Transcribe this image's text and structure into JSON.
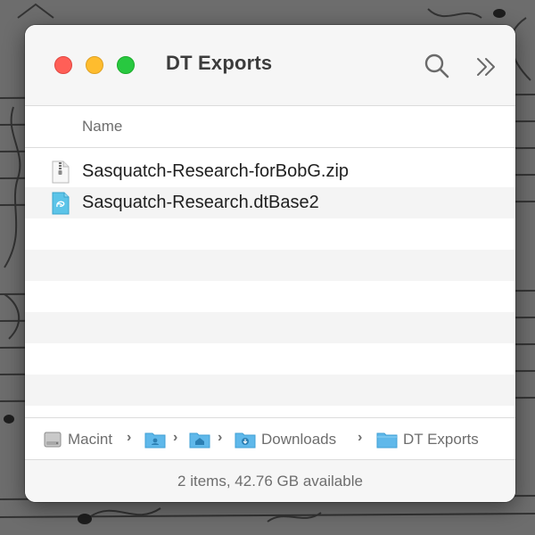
{
  "window": {
    "title": "DT Exports"
  },
  "toolbar": {
    "buttons": [
      {
        "icon": "close-button"
      },
      {
        "icon": "minimize-button"
      },
      {
        "icon": "zoom-button"
      },
      {
        "icon": "search-icon"
      },
      {
        "icon": "chevron-double-right-icon"
      }
    ]
  },
  "columns": {
    "name": "Name"
  },
  "files": [
    {
      "name": "Sasquatch-Research-forBobG.zip",
      "icon": "zip-file-icon"
    },
    {
      "name": "Sasquatch-Research.dtBase2",
      "icon": "devonthink-database-icon"
    }
  ],
  "path": {
    "items": [
      {
        "label": "Macint",
        "icon": "hard-drive-icon"
      },
      {
        "label": "",
        "icon": "user-folder-icon"
      },
      {
        "label": "",
        "icon": "home-folder-icon"
      },
      {
        "label": "Downloads",
        "icon": "downloads-folder-icon"
      },
      {
        "label": "DT Exports",
        "icon": "folder-icon"
      }
    ],
    "separator": "›"
  },
  "status": {
    "text": "2 items, 42.76 GB available"
  },
  "colors": {
    "close": "#ff5f57",
    "minimize": "#febc2e",
    "zoom": "#28c840",
    "folder_blue": "#5fb8ea",
    "text_primary": "#1f1f1f",
    "text_secondary": "#6e6e6e"
  }
}
